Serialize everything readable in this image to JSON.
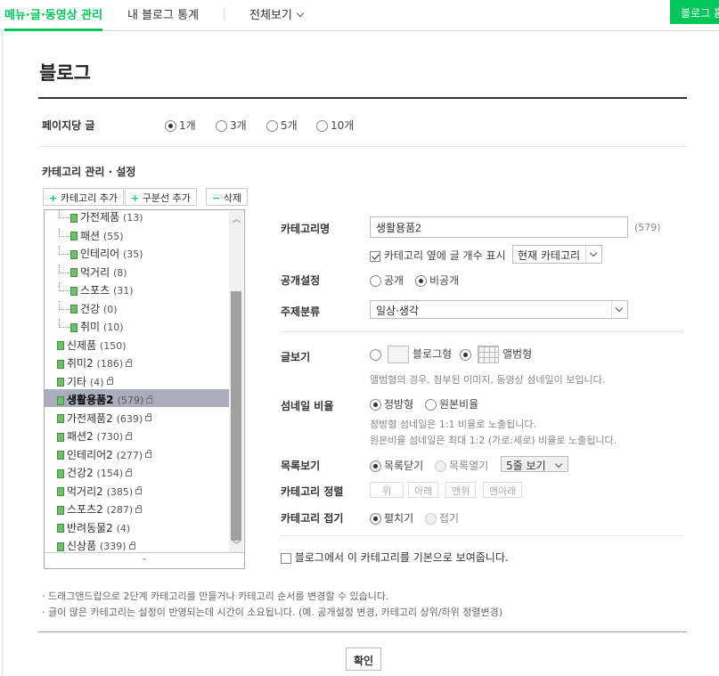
{
  "topnav": {
    "tab_active": "메뉴·글·동영상 관리",
    "tab_stats": "내 블로그 통계",
    "tab_all": "전체보기",
    "right_button": "블로그 홈"
  },
  "page": {
    "title": "블로그"
  },
  "posts_per_page": {
    "label": "페이지당 글",
    "options": [
      "1개",
      "3개",
      "5개",
      "10개"
    ],
    "selected": "1개"
  },
  "category": {
    "section_title": "카테고리 관리 · 설정",
    "add_category": "카테고리 추가",
    "add_divider": "구분선 추가",
    "delete": "삭제",
    "items": [
      {
        "name": "가전제품",
        "count": "(13)",
        "level": 2,
        "locked": false
      },
      {
        "name": "패션",
        "count": "(55)",
        "level": 2,
        "locked": false
      },
      {
        "name": "인테리어",
        "count": "(35)",
        "level": 2,
        "locked": false
      },
      {
        "name": "먹거리",
        "count": "(8)",
        "level": 2,
        "locked": false
      },
      {
        "name": "스포츠",
        "count": "(31)",
        "level": 2,
        "locked": false
      },
      {
        "name": "건강",
        "count": "(0)",
        "level": 2,
        "locked": false
      },
      {
        "name": "취미",
        "count": "(10)",
        "level": 2,
        "locked": false
      },
      {
        "name": "신제품",
        "count": "(150)",
        "level": 1,
        "locked": false
      },
      {
        "name": "취미2",
        "count": "(186)",
        "level": 1,
        "locked": true
      },
      {
        "name": "기타",
        "count": "(4)",
        "level": 1,
        "locked": true
      },
      {
        "name": "생활용품2",
        "count": "(579)",
        "level": 1,
        "locked": true,
        "selected": true
      },
      {
        "name": "가전제품2",
        "count": "(639)",
        "level": 1,
        "locked": true
      },
      {
        "name": "패션2",
        "count": "(730)",
        "level": 1,
        "locked": true
      },
      {
        "name": "인테리어2",
        "count": "(277)",
        "level": 1,
        "locked": true
      },
      {
        "name": "건강2",
        "count": "(154)",
        "level": 1,
        "locked": true
      },
      {
        "name": "먹거리2",
        "count": "(385)",
        "level": 1,
        "locked": true
      },
      {
        "name": "스포츠2",
        "count": "(287)",
        "level": 1,
        "locked": true
      },
      {
        "name": "반려동물2",
        "count": "(4)",
        "level": 1,
        "locked": false
      },
      {
        "name": "신상품",
        "count": "(339)",
        "level": 1,
        "locked": true
      }
    ]
  },
  "detail": {
    "name_label": "카테고리명",
    "name_value": "생활용품2",
    "name_count": "(579)",
    "show_count_label": "카테고리 옆에 글 개수 표시",
    "show_count_checked": true,
    "count_scope": "현재 카테고리",
    "visibility_label": "공개설정",
    "visibility_public": "공개",
    "visibility_private": "비공개",
    "visibility_selected": "비공개",
    "topic_label": "주제분류",
    "topic_value": "일상·생각",
    "view_label": "글보기",
    "view_blog": "블로그형",
    "view_album": "앨범형",
    "view_selected": "앨범형",
    "view_hint": "앨범형의 경우, 첨부된 이미지, 동영상 섬네일이 보입니다.",
    "thumb_label": "섬네일 비율",
    "thumb_square": "정방형",
    "thumb_original": "원본비율",
    "thumb_selected": "정방형",
    "thumb_hint1": "정방형 섬네일은 1:1 비율로 노출됩니다.",
    "thumb_hint2": "원본비율 섬네일은 최대 1:2 (가로:세로) 비율로 노출됩니다.",
    "list_label": "목록보기",
    "list_close": "목록닫기",
    "list_open": "목록열기",
    "list_selected": "목록닫기",
    "list_rows": "5줄 보기",
    "sort_label": "카테고리 정렬",
    "sort_up": "위",
    "sort_down": "아래",
    "sort_top": "맨위",
    "sort_bottom": "맨아래",
    "fold_label": "카테고리 접기",
    "fold_expand": "펼치기",
    "fold_collapse": "접기",
    "fold_selected": "펼치기",
    "default_label": "블로그에서 이 카테고리를 기본으로 보여줍니다.",
    "default_checked": false
  },
  "notes": {
    "note1": "· 드래그앤드랍으로 2단계 카테고리를 만들거나 카테고리 순서를 변경할 수 있습니다.",
    "note2": "· 글이 많은 카테고리는 설정이 반영되는데 시간이 소요됩니다. (예. 공개설정 변경, 카테고리 상위/하위 정렬변경)"
  },
  "confirm": "확인",
  "colors": {
    "brand": "#03c75a",
    "selected_row": "#a9aebd"
  }
}
